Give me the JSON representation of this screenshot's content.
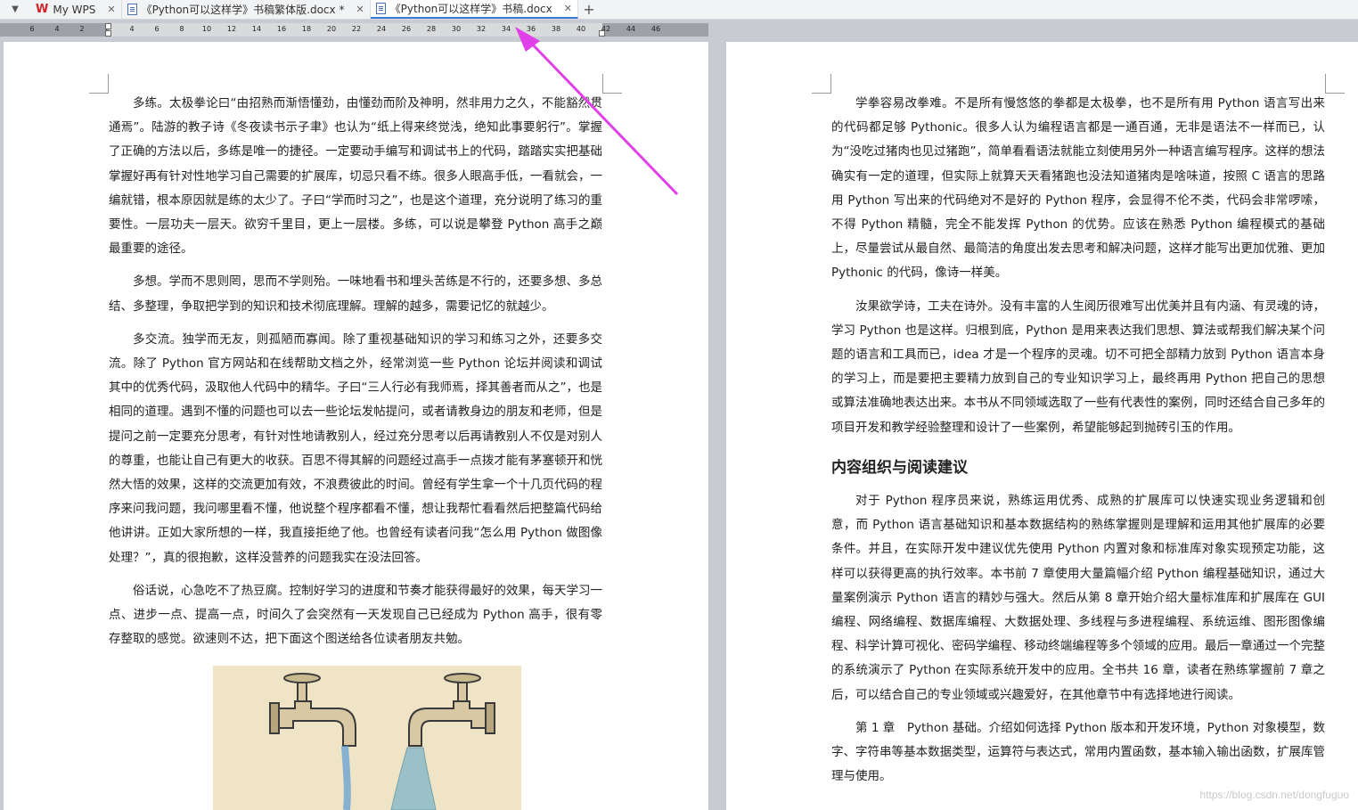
{
  "tabbar": {
    "menu_glyph": "▼",
    "tabs": [
      {
        "label": "My WPS",
        "type": "home"
      },
      {
        "label": "《Python可以这样学》书稿繁体版.docx *",
        "type": "doc"
      },
      {
        "label": "《Python可以这样学》书稿.docx",
        "type": "doc",
        "active": true
      }
    ],
    "close_glyph": "✕",
    "add_glyph": "+"
  },
  "ruler": {
    "labels": [
      "6",
      "4",
      "2",
      "2",
      "4",
      "6",
      "8",
      "10",
      "12",
      "14",
      "16",
      "18",
      "20",
      "22",
      "24",
      "26",
      "28",
      "30",
      "32",
      "34",
      "36",
      "38",
      "40",
      "42",
      "44",
      "46"
    ]
  },
  "left_page": {
    "paragraphs": [
      "多练。太极拳论曰“由招熟而渐悟懂劲，由懂劲而阶及神明，然非用力之久，不能豁然贯通焉”。陆游的教子诗《冬夜读书示子聿》也认为“纸上得来终觉浅，绝知此事要躬行”。掌握了正确的方法以后，多练是唯一的捷径。一定要动手编写和调试书上的代码，踏踏实实把基础掌握好再有针对性地学习自己需要的扩展库，切忌只看不练。很多人眼高手低，一看就会，一编就错，根本原因就是练的太少了。子曰“学而时习之”，也是这个道理，充分说明了练习的重要性。一层功夫一层天。欲穷千里目，更上一层楼。多练，可以说是攀登 Python 高手之巅最重要的途径。",
      "多想。学而不思则罔，思而不学则殆。一味地看书和埋头苦练是不行的，还要多想、多总结、多整理，争取把学到的知识和技术彻底理解。理解的越多，需要记忆的就越少。",
      "多交流。独学而无友，则孤陋而寡闻。除了重视基础知识的学习和练习之外，还要多交流。除了 Python 官方网站和在线帮助文档之外，经常浏览一些 Python 论坛并阅读和调试其中的优秀代码，汲取他人代码中的精华。子曰“三人行必有我师焉，择其善者而从之”，也是相同的道理。遇到不懂的问题也可以去一些论坛发帖提问，或者请教身边的朋友和老师，但是提问之前一定要充分思考，有针对性地请教别人，经过充分思考以后再请教别人不仅是对别人的尊重，也能让自己有更大的收获。百思不得其解的问题经过高手一点拨才能有茅塞顿开和恍然大悟的效果，这样的交流更加有效，不浪费彼此的时间。曾经有学生拿一个十几页代码的程序来问我问题，我问哪里看不懂，他说整个程序都看不懂，想让我帮忙看看然后把整篇代码给他讲讲。正如大家所想的一样，我直接拒绝了他。也曾经有读者问我“怎么用 Python 做图像处理？”，真的很抱歉，这样没营养的问题我实在没法回答。",
      "俗话说，心急吃不了热豆腐。控制好学习的进度和节奏才能获得最好的效果，每天学习一点、进步一点、提高一点，时间久了会突然有一天发现自己已经成为 Python 高手，很有零存整取的感觉。欲速则不达，把下面这个图送给各位读者朋友共勉。"
    ]
  },
  "right_page": {
    "paragraphs_before": [
      "学拳容易改拳难。不是所有慢悠悠的拳都是太极拳，也不是所有用 Python 语言写出来的代码都足够 Pythonic。很多人认为编程语言都是一通百通，无非是语法不一样而已，认为“没吃过猪肉也见过猪跑”，简单看看语法就能立刻使用另外一种语言编写程序。这样的想法确实有一定的道理，但实际上就算天天看猪跑也没法知道猪肉是啥味道，按照 C 语言的思路用 Python 写出来的代码绝对不是好的 Python 程序，会显得不伦不类，代码会非常啰嗦，不得 Python 精髓，完全不能发挥 Python 的优势。应该在熟悉 Python 编程模式的基础上，尽量尝试从最自然、最简洁的角度出发去思考和解决问题，这样才能写出更加优雅、更加 Pythonic 的代码，像诗一样美。",
      "汝果欲学诗，工夫在诗外。没有丰富的人生阅历很难写出优美并且有内涵、有灵魂的诗，学习 Python 也是这样。归根到底，Python 是用来表达我们思想、算法或帮我们解决某个问题的语言和工具而已，idea 才是一个程序的灵魂。切不可把全部精力放到 Python 语言本身的学习上，而是要把主要精力放到自己的专业知识学习上，最终再用 Python 把自己的思想或算法准确地表达出来。本书从不同领域选取了一些有代表性的案例，同时还结合自己多年的项目开发和教学经验整理和设计了一些案例，希望能够起到抛砖引玉的作用。"
    ],
    "heading": "内容组织与阅读建议",
    "paragraphs_after": [
      "对于 Python 程序员来说，熟练运用优秀、成熟的扩展库可以快速实现业务逻辑和创意，而 Python 语言基础知识和基本数据结构的熟练掌握则是理解和运用其他扩展库的必要条件。并且，在实际开发中建议优先使用 Python 内置对象和标准库对象实现预定功能，这样可以获得更高的执行效率。本书前 7 章使用大量篇幅介绍 Python 编程基础知识，通过大量案例演示 Python 语言的精妙与强大。然后从第 8 章开始介绍大量标准库和扩展库在 GUI 编程、网络编程、数据库编程、大数据处理、多线程与多进程编程、系统运维、图形图像编程、科学计算可视化、密码学编程、移动终端编程等多个领域的应用。最后一章通过一个完整的系统演示了 Python 在实际系统开发中的应用。全书共 16 章，读者在熟练掌握前 7 章之后，可以结合自己的专业领域或兴趣爱好，在其他章节中有选择地进行阅读。",
      "第 1 章　Python 基础。介绍如何选择 Python 版本和开发环境，Python 对象模型，数字、字符串等基本数据类型，运算符与表达式，常用内置函数，基本输入输出函数，扩展库管理与使用。"
    ],
    "watermark": "https://blog.csdn.net/dongfuguo"
  },
  "colors": {
    "wps_red": "#d2242a",
    "active_tab_underline": "#3d7ad8",
    "annotation_arrow": "#e040e8"
  }
}
